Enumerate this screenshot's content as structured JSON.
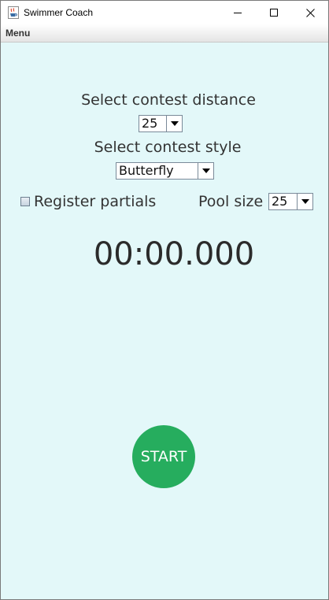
{
  "window": {
    "title": "Swimmer Coach"
  },
  "menubar": {
    "menu_label": "Menu"
  },
  "distance": {
    "label": "Select contest distance",
    "selected": "25"
  },
  "style": {
    "label": "Select contest style",
    "selected": "Butterfly"
  },
  "partials": {
    "label": "Register partials",
    "checked": false
  },
  "pool": {
    "label": "Pool size",
    "selected": "25"
  },
  "timer": {
    "value": "00:00.000"
  },
  "start_button": {
    "label": "START"
  },
  "colors": {
    "background": "#e3f8f9",
    "start_button": "#26ad5e",
    "text": "#333333"
  },
  "icons": {
    "app": "java-cup-icon",
    "minimize": "minimize-icon",
    "maximize": "maximize-icon",
    "close": "close-icon",
    "dropdown": "chevron-down-icon"
  }
}
